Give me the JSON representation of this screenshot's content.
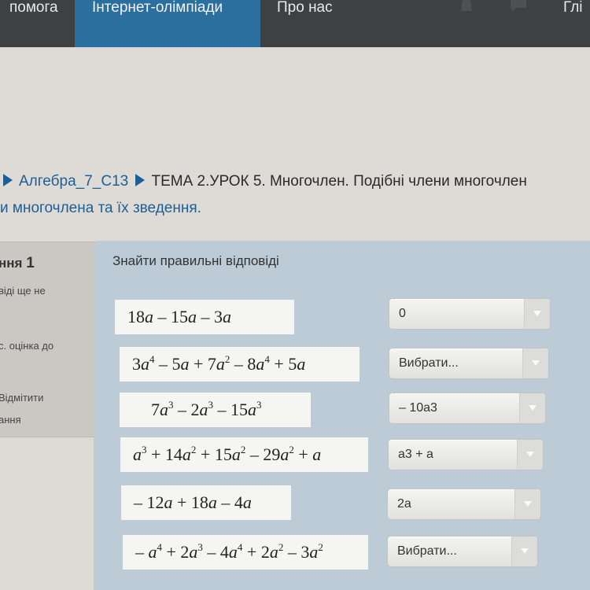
{
  "nav": {
    "help": "помога",
    "olympiads": "Інтернет-олімпіади",
    "about": "Про нас",
    "right": "Глі",
    "icons": [
      "bell-icon",
      "chat-icon"
    ],
    "active_color": "#2b6f9e"
  },
  "breadcrumb": {
    "course": "Алгебра_7_С13",
    "topic": "ТЕМА 2.УРОК 5. Многочлен. Подібні члени многочлен",
    "topic_cont": "и многочлена та їх зведення."
  },
  "info": {
    "title_prefix": "ння",
    "number": "1",
    "line1": "віді ще не",
    "line2": "с. оцінка до",
    "line3": "Відмітити",
    "line4": "ання"
  },
  "question": {
    "prompt": "Знайти правильні відповіді",
    "rows": [
      {
        "expression": "18a – 15a – 3a",
        "answer": "0"
      },
      {
        "expression": "3a⁴ – 5a + 7a² – 8a⁴ + 5a",
        "answer": "Вибрати..."
      },
      {
        "expression": "7a³ – 2a³ – 15a³",
        "answer": "– 10a3"
      },
      {
        "expression": "a³ + 14a² + 15a² – 29a² + a",
        "answer": "a3 + a"
      },
      {
        "expression": "– 12a + 18a – 4a",
        "answer": "2a"
      },
      {
        "expression": "– a⁴ + 2a³ – 4a⁴ + 2a² – 3a²",
        "answer": "Вибрати..."
      }
    ]
  }
}
